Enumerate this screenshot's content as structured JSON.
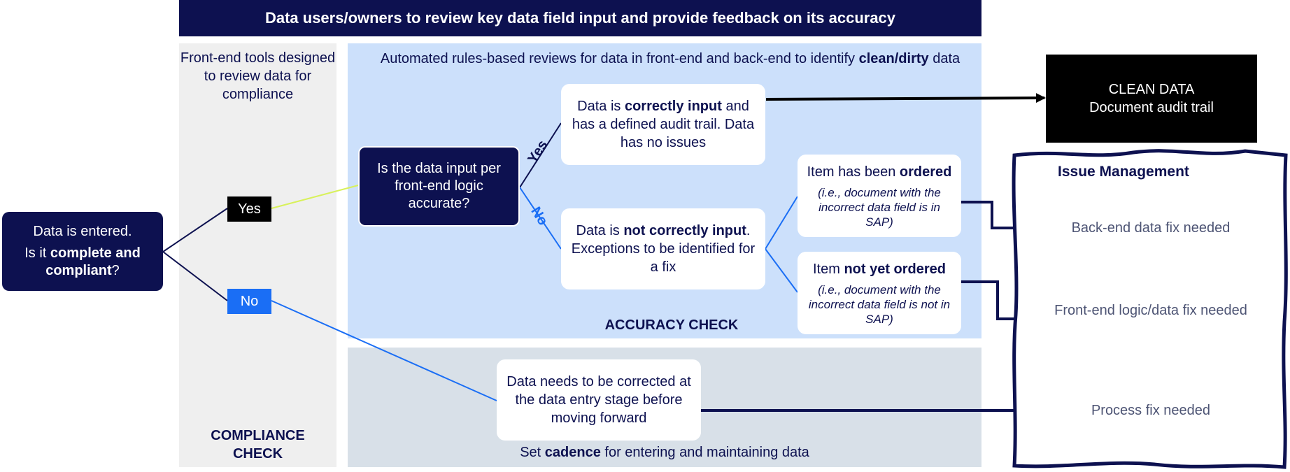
{
  "banner": {
    "title": "Data users/owners to review key data field input and provide feedback on its accuracy"
  },
  "compliance": {
    "heading": "Front-end tools designed to review data for compliance",
    "footer": "COMPLIANCE CHECK"
  },
  "accuracy": {
    "heading_pre": "Automated rules-based reviews for data in front-end and back-end to identify ",
    "heading_bold": "clean/dirty",
    "heading_post": " data",
    "footer": "ACCURACY CHECK"
  },
  "process": {
    "footer_pre": "Set ",
    "footer_bold": "cadence",
    "footer_post": " for entering and maintaining data",
    "correction_box": "Data needs to be corrected at the data entry stage before moving forward"
  },
  "start": {
    "line1": "Data is entered.",
    "line2_pre": "Is it ",
    "line2_bold": "complete and compliant",
    "line2_post": "?"
  },
  "decision_yes": "Yes",
  "decision_no": "No",
  "question_box": "Is the data input per front-end logic accurate?",
  "branch_yes": "Yes",
  "branch_no": "No",
  "correct_box": {
    "pre": "Data is ",
    "bold": "correctly input",
    "post": " and has a defined audit trail. Data has no issues"
  },
  "incorrect_box": {
    "pre": "Data is ",
    "bold": "not correctly input",
    "post": ". Exceptions to be identified for a fix"
  },
  "ordered_box": {
    "pre": "Item has been ",
    "bold": "ordered",
    "note": "(i.e., document with the incorrect data field is in SAP)"
  },
  "not_ordered_box": {
    "pre": "Item ",
    "bold": "not yet ordered",
    "note": "(i.e., document with the incorrect data field  is not in SAP)"
  },
  "clean_data": {
    "title": "CLEAN DATA",
    "subtitle": "Document audit trail"
  },
  "issue_management": {
    "title": "Issue Management",
    "items": [
      "Back-end data fix needed",
      "Front-end logic/data fix needed",
      "Process fix needed"
    ]
  },
  "colors": {
    "navy": "#0d1150",
    "blue": "#1a6ef5",
    "lime": "#d8f15a",
    "light_blue": "#cce0fb",
    "gray": "#efefef",
    "slate": "#d8e0e8"
  }
}
